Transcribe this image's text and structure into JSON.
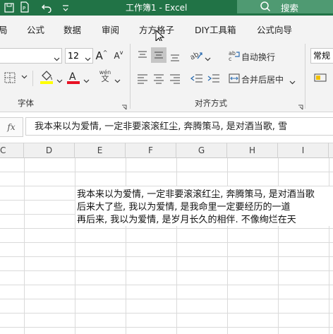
{
  "window": {
    "title": "工作簿1  -  Excel",
    "search_placeholder": "搜索"
  },
  "menu": {
    "items": [
      "局",
      "公式",
      "数据",
      "审阅",
      "方方格子",
      "DIY工具箱",
      "公式向导"
    ]
  },
  "ribbon": {
    "font_size": "12",
    "font_group_label": "字体",
    "align_group_label": "对齐方式",
    "wrap_text_label": "自动换行",
    "merge_center_label": "合并后居中",
    "number_format": "常规",
    "increase_font_glyph": "A",
    "decrease_font_glyph": "A",
    "phonetic_glyph": "wén"
  },
  "formula_bar": {
    "fx_label": "fx",
    "content": "我本来以为爱情, 一定非要滚滚红尘, 奔腾策马, 是对酒当歌, 雪"
  },
  "columns": [
    "C",
    "D",
    "E",
    "F",
    "G",
    "H",
    "I"
  ],
  "cells": {
    "line1": "我本来以为爱情, 一定非要滚滚红尘, 奔腾策马, 是对酒当歌",
    "line2": "后来大了些, 我以为爱情, 是我命里一定要经历的一道",
    "line3": "再后来, 我以为爱情, 是岁月长久的相伴. 不像绚烂在天"
  },
  "colors": {
    "excel_green": "#217346",
    "fill_yellow": "#ffff00",
    "font_red": "#e81123"
  }
}
